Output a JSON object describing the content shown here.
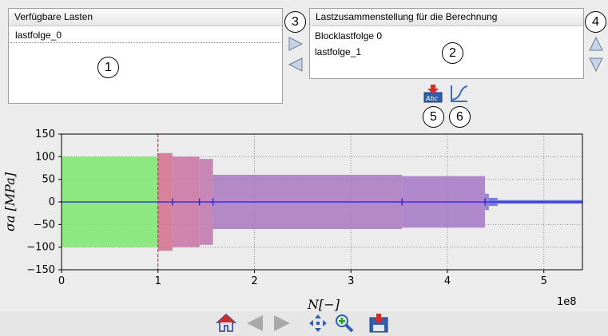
{
  "left_panel": {
    "title": "Verfügbare Lasten",
    "items": [
      "lastfolge_0"
    ]
  },
  "right_panel": {
    "title": "Lastzusammenstellung für die Berechnung",
    "items": [
      "Blocklastfolge 0",
      "lastfolge_1"
    ]
  },
  "markers": [
    "1",
    "2",
    "3",
    "4",
    "5",
    "6"
  ],
  "icons": {
    "move_right": "arrow-right-icon",
    "move_left": "arrow-left-icon",
    "move_up": "arrow-up-icon",
    "move_down": "arrow-down-icon",
    "export_text": "export-abc-icon",
    "curve": "curve-icon",
    "toolbar": [
      "home-icon",
      "back-icon",
      "forward-icon",
      "pan-icon",
      "zoom-icon",
      "save-icon"
    ]
  },
  "chart_data": {
    "type": "area",
    "xlabel": "N[−]",
    "ylabel": "σa [MPa]",
    "x_offset_label": "1e8",
    "xlim": [
      0,
      5.4
    ],
    "ylim": [
      -150,
      150
    ],
    "x_ticks": [
      0,
      1,
      2,
      3,
      4,
      5
    ],
    "y_ticks": [
      150,
      100,
      50,
      0,
      -50,
      -100,
      -150
    ],
    "y_tick_labels": [
      "150",
      "100",
      "50",
      "0",
      "−50",
      "−100",
      "−150"
    ],
    "grid": true,
    "blocks": [
      {
        "x0": 0.0,
        "x1": 1.0,
        "amp": 100,
        "color": "#7ee86e"
      },
      {
        "x0": 1.0,
        "x1": 1.15,
        "amp": 108,
        "color": "#d1708c"
      },
      {
        "x0": 1.15,
        "x1": 1.43,
        "amp": 100,
        "color": "#c972a2"
      },
      {
        "x0": 1.43,
        "x1": 1.57,
        "amp": 95,
        "color": "#c075ae"
      },
      {
        "x0": 1.57,
        "x1": 3.53,
        "amp": 60,
        "color": "#a978c0"
      },
      {
        "x0": 3.53,
        "x1": 4.39,
        "amp": 57,
        "color": "#a478c6"
      },
      {
        "x0": 4.39,
        "x1": 4.43,
        "amp": 18,
        "color": "#8a72d4"
      },
      {
        "x0": 4.43,
        "x1": 4.52,
        "amp": 9,
        "color": "#6a6ad8"
      },
      {
        "x0": 4.52,
        "x1": 5.4,
        "amp": 4,
        "color": "#5a64e0"
      }
    ],
    "markers_x": [
      1.15,
      1.43,
      1.57,
      3.53,
      4.39
    ],
    "divider_x": 1.0,
    "mean_line": 0
  }
}
